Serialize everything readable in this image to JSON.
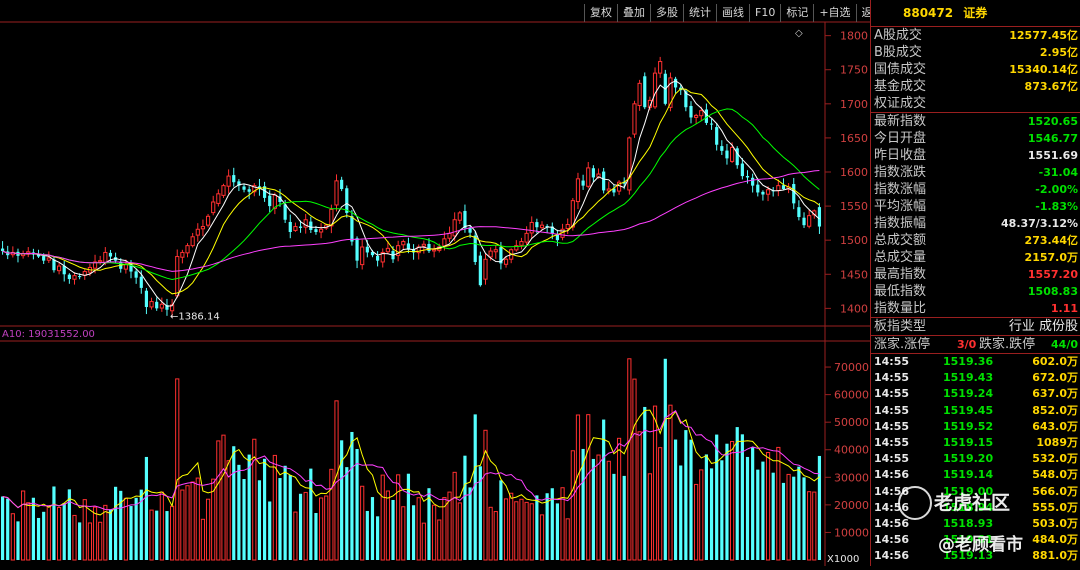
{
  "toolbar": [
    "复权",
    "叠加",
    "多股",
    "统计",
    "画线",
    "F10",
    "标记",
    "+自选",
    "返回"
  ],
  "price_axis_ticks": [
    "1800",
    "1750",
    "1700",
    "1650",
    "1600",
    "1550",
    "1500",
    "1450",
    "1400"
  ],
  "volume_axis_ticks": [
    "70000",
    "60000",
    "50000",
    "40000",
    "30000",
    "20000",
    "10000"
  ],
  "volume_unit": "X1000",
  "volume_ma_label": "A10: 19031552.00",
  "low_marker": "←1386.14",
  "chart_data": {
    "type": "candlestick",
    "x": [
      1,
      2,
      3,
      4,
      5,
      6,
      7,
      8,
      9,
      10,
      11,
      12,
      13,
      14,
      15,
      16,
      17,
      18,
      19,
      20,
      21,
      22,
      23,
      24,
      25,
      26,
      27,
      28,
      29,
      30,
      31,
      32,
      33,
      34,
      35,
      36,
      37,
      38,
      39,
      40,
      41,
      42,
      43,
      44,
      45,
      46,
      47,
      48,
      49,
      50,
      51,
      52,
      53,
      54,
      55,
      56,
      57,
      58,
      59,
      60,
      61,
      62,
      63,
      64,
      65,
      66,
      67,
      68,
      69,
      70,
      71,
      72,
      73,
      74,
      75,
      76,
      77,
      78,
      79,
      80,
      81,
      82,
      83,
      84,
      85,
      86,
      87,
      88,
      89,
      90,
      91,
      92,
      93,
      94,
      95,
      96,
      97,
      98,
      99,
      100,
      101,
      102,
      103,
      104,
      105,
      106,
      107,
      108,
      109,
      110,
      111,
      112,
      113,
      114,
      115,
      116,
      117,
      118,
      119,
      120,
      121,
      122,
      123,
      124,
      125,
      126,
      127,
      128,
      129,
      130,
      131,
      132,
      133,
      134,
      135,
      136,
      137,
      138,
      139,
      140,
      141,
      142,
      143,
      144,
      145,
      146,
      147,
      148,
      149,
      150,
      151,
      152,
      153,
      154,
      155,
      156,
      157,
      158,
      159,
      160
    ],
    "close": [
      1484,
      1478,
      1482,
      1477,
      1480,
      1483,
      1479,
      1476,
      1470,
      1474,
      1456,
      1462,
      1450,
      1443,
      1448,
      1447,
      1454,
      1460,
      1468,
      1470,
      1482,
      1476,
      1470,
      1458,
      1464,
      1454,
      1445,
      1430,
      1402,
      1410,
      1400,
      1406,
      1398,
      1405,
      1476,
      1482,
      1492,
      1505,
      1516,
      1520,
      1535,
      1556,
      1568,
      1580,
      1594,
      1585,
      1580,
      1574,
      1571,
      1580,
      1576,
      1562,
      1550,
      1566,
      1556,
      1530,
      1512,
      1520,
      1518,
      1530,
      1515,
      1512,
      1516,
      1522,
      1545,
      1587,
      1575,
      1540,
      1498,
      1470,
      1490,
      1482,
      1478,
      1470,
      1482,
      1488,
      1472,
      1492,
      1498,
      1486,
      1482,
      1490,
      1494,
      1484,
      1486,
      1490,
      1502,
      1510,
      1530,
      1540,
      1518,
      1511,
      1468,
      1434,
      1472,
      1484,
      1486,
      1466,
      1472,
      1486,
      1492,
      1498,
      1510,
      1526,
      1519,
      1522,
      1519,
      1510,
      1500,
      1516,
      1523,
      1558,
      1590,
      1580,
      1606,
      1592,
      1597,
      1573,
      1575,
      1570,
      1585,
      1583,
      1650,
      1700,
      1730,
      1695,
      1705,
      1745,
      1762,
      1700,
      1738,
      1724,
      1720,
      1695,
      1680,
      1683,
      1690,
      1672,
      1670,
      1640,
      1631,
      1620,
      1636,
      1610,
      1594,
      1592,
      1580,
      1570,
      1567,
      1574,
      1572,
      1580,
      1575,
      1578,
      1554,
      1534,
      1522,
      1536,
      1543,
      1520
    ],
    "ma_periods": [
      5,
      10,
      20,
      60
    ],
    "volume_unit": 1000,
    "volume_ma": 19031552.0
  },
  "panel": {
    "code": "880472",
    "name": "证券",
    "rows": [
      {
        "label": "A股成交",
        "value": "12577.45亿",
        "color": "#ffd700"
      },
      {
        "label": "B股成交",
        "value": "2.95亿",
        "color": "#ffd700"
      },
      {
        "label": "国债成交",
        "value": "15340.14亿",
        "color": "#ffd700"
      },
      {
        "label": "基金成交",
        "value": "873.67亿",
        "color": "#ffd700"
      },
      {
        "label": "权证成交",
        "value": "",
        "color": "#ffd700"
      },
      {
        "label": "最新指数",
        "value": "1520.65",
        "color": "#00e000",
        "sep": true
      },
      {
        "label": "今日开盘",
        "value": "1546.77",
        "color": "#00e000"
      },
      {
        "label": "昨日收盘",
        "value": "1551.69",
        "color": "#e8e8e8"
      },
      {
        "label": "指数涨跌",
        "value": "-31.04",
        "color": "#00e000"
      },
      {
        "label": "指数涨幅",
        "value": "-2.00%",
        "color": "#00e000"
      },
      {
        "label": "平均涨幅",
        "value": "-1.83%",
        "color": "#00e000"
      },
      {
        "label": "指数振幅",
        "value": "48.37/3.12%",
        "color": "#e8e8e8"
      },
      {
        "label": "总成交额",
        "value": "273.44亿",
        "color": "#ffd700"
      },
      {
        "label": "总成交量",
        "value": "2157.0万",
        "color": "#ffd700"
      },
      {
        "label": "最高指数",
        "value": "1557.20",
        "color": "#ff3030"
      },
      {
        "label": "最低指数",
        "value": "1508.83",
        "color": "#00e000"
      },
      {
        "label": "指数量比",
        "value": "1.11",
        "color": "#ff3030"
      }
    ],
    "board": {
      "label": "板指类型",
      "value": "行业 成份股"
    },
    "breadth": {
      "up_label": "涨家.涨停",
      "up": "3/0",
      "down_label": "跌家.跌停",
      "down": "44/0"
    },
    "ticks": [
      {
        "t": "14:55",
        "p": "1519.36",
        "v": "602.0万"
      },
      {
        "t": "14:55",
        "p": "1519.43",
        "v": "672.0万"
      },
      {
        "t": "14:55",
        "p": "1519.24",
        "v": "637.0万"
      },
      {
        "t": "14:55",
        "p": "1519.45",
        "v": "852.0万"
      },
      {
        "t": "14:55",
        "p": "1519.52",
        "v": "643.0万"
      },
      {
        "t": "14:55",
        "p": "1519.15",
        "v": "1089万"
      },
      {
        "t": "14:55",
        "p": "1519.20",
        "v": "532.0万"
      },
      {
        "t": "14:56",
        "p": "1519.14",
        "v": "548.0万"
      },
      {
        "t": "14:56",
        "p": "1519.00",
        "v": "566.0万"
      },
      {
        "t": "14:56",
        "p": "1518.94",
        "v": "555.0万"
      },
      {
        "t": "14:56",
        "p": "1518.93",
        "v": "503.0万"
      },
      {
        "t": "14:56",
        "p": "1519.01",
        "v": "484.0万"
      },
      {
        "t": "14:56",
        "p": "1519.13",
        "v": "881.0万"
      }
    ]
  },
  "watermark": {
    "line1": "老虎社区",
    "line2": "@老顾看市"
  }
}
